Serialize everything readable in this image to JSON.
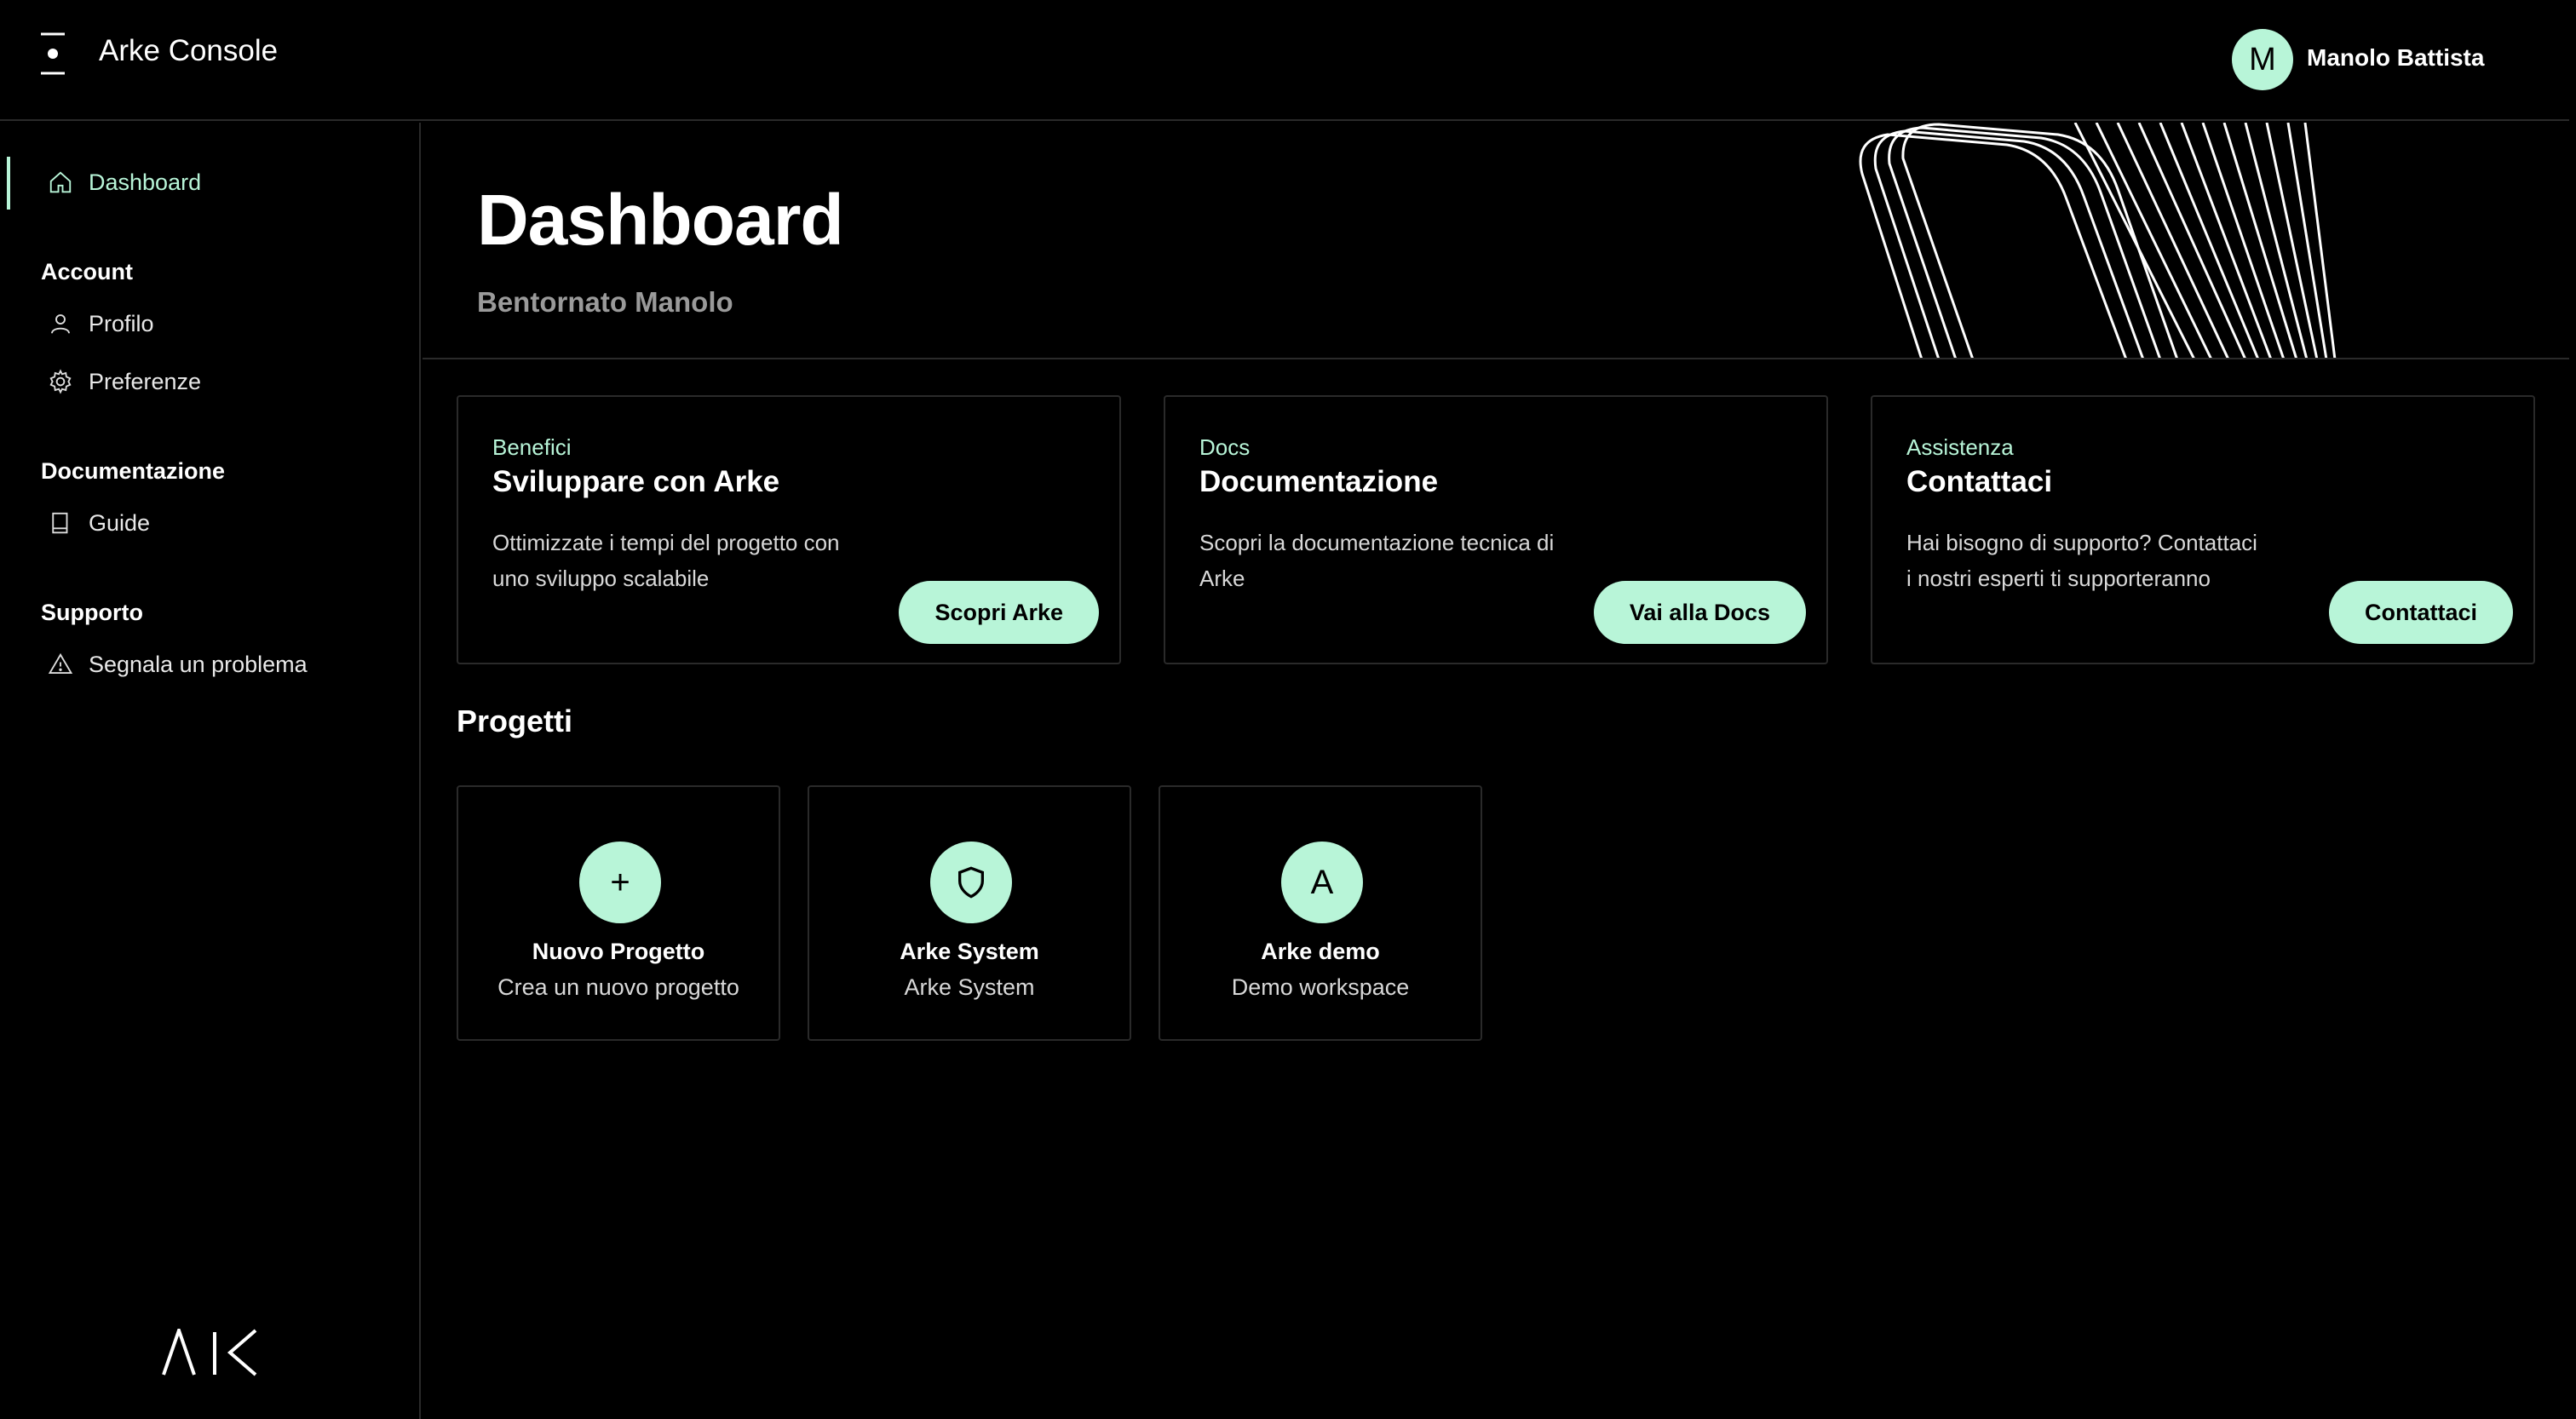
{
  "app": {
    "title": "Arke Console"
  },
  "user": {
    "initial": "M",
    "name": "Manolo Battista"
  },
  "sidebar": {
    "dashboard": "Dashboard",
    "sections": [
      {
        "heading": "Account",
        "items": [
          {
            "label": "Profilo",
            "icon": "user-icon"
          },
          {
            "label": "Preferenze",
            "icon": "gear-icon"
          }
        ]
      },
      {
        "heading": "Documentazione",
        "items": [
          {
            "label": "Guide",
            "icon": "book-icon"
          }
        ]
      },
      {
        "heading": "Supporto",
        "items": [
          {
            "label": "Segnala un problema",
            "icon": "warning-icon"
          }
        ]
      }
    ]
  },
  "hero": {
    "title": "Dashboard",
    "subtitle": "Bentornato Manolo"
  },
  "cards": [
    {
      "eyebrow": "Benefici",
      "title": "Sviluppare con Arke",
      "desc": "Ottimizzate i tempi del progetto con uno sviluppo scalabile",
      "button": "Scopri Arke"
    },
    {
      "eyebrow": "Docs",
      "title": "Documentazione",
      "desc": "Scopri la documentazione tecnica di Arke",
      "button": "Vai alla Docs"
    },
    {
      "eyebrow": "Assistenza",
      "title": "Contattaci",
      "desc": "Hai bisogno di supporto? Contattaci i nostri esperti ti supporteranno",
      "button": "Contattaci"
    }
  ],
  "projects": {
    "title": "Progetti",
    "items": [
      {
        "icon_text": "+",
        "icon": "plus-icon",
        "name": "Nuovo Progetto",
        "sub": "Crea un nuovo progetto"
      },
      {
        "icon_text": "",
        "icon": "shield-icon",
        "name": "Arke System",
        "sub": "Arke System"
      },
      {
        "icon_text": "A",
        "icon": "letter-a-icon",
        "name": "Arke demo",
        "sub": "Demo workspace"
      }
    ]
  },
  "colors": {
    "accent": "#b8f5d8",
    "background": "#000000",
    "border": "#2a2a2a"
  }
}
